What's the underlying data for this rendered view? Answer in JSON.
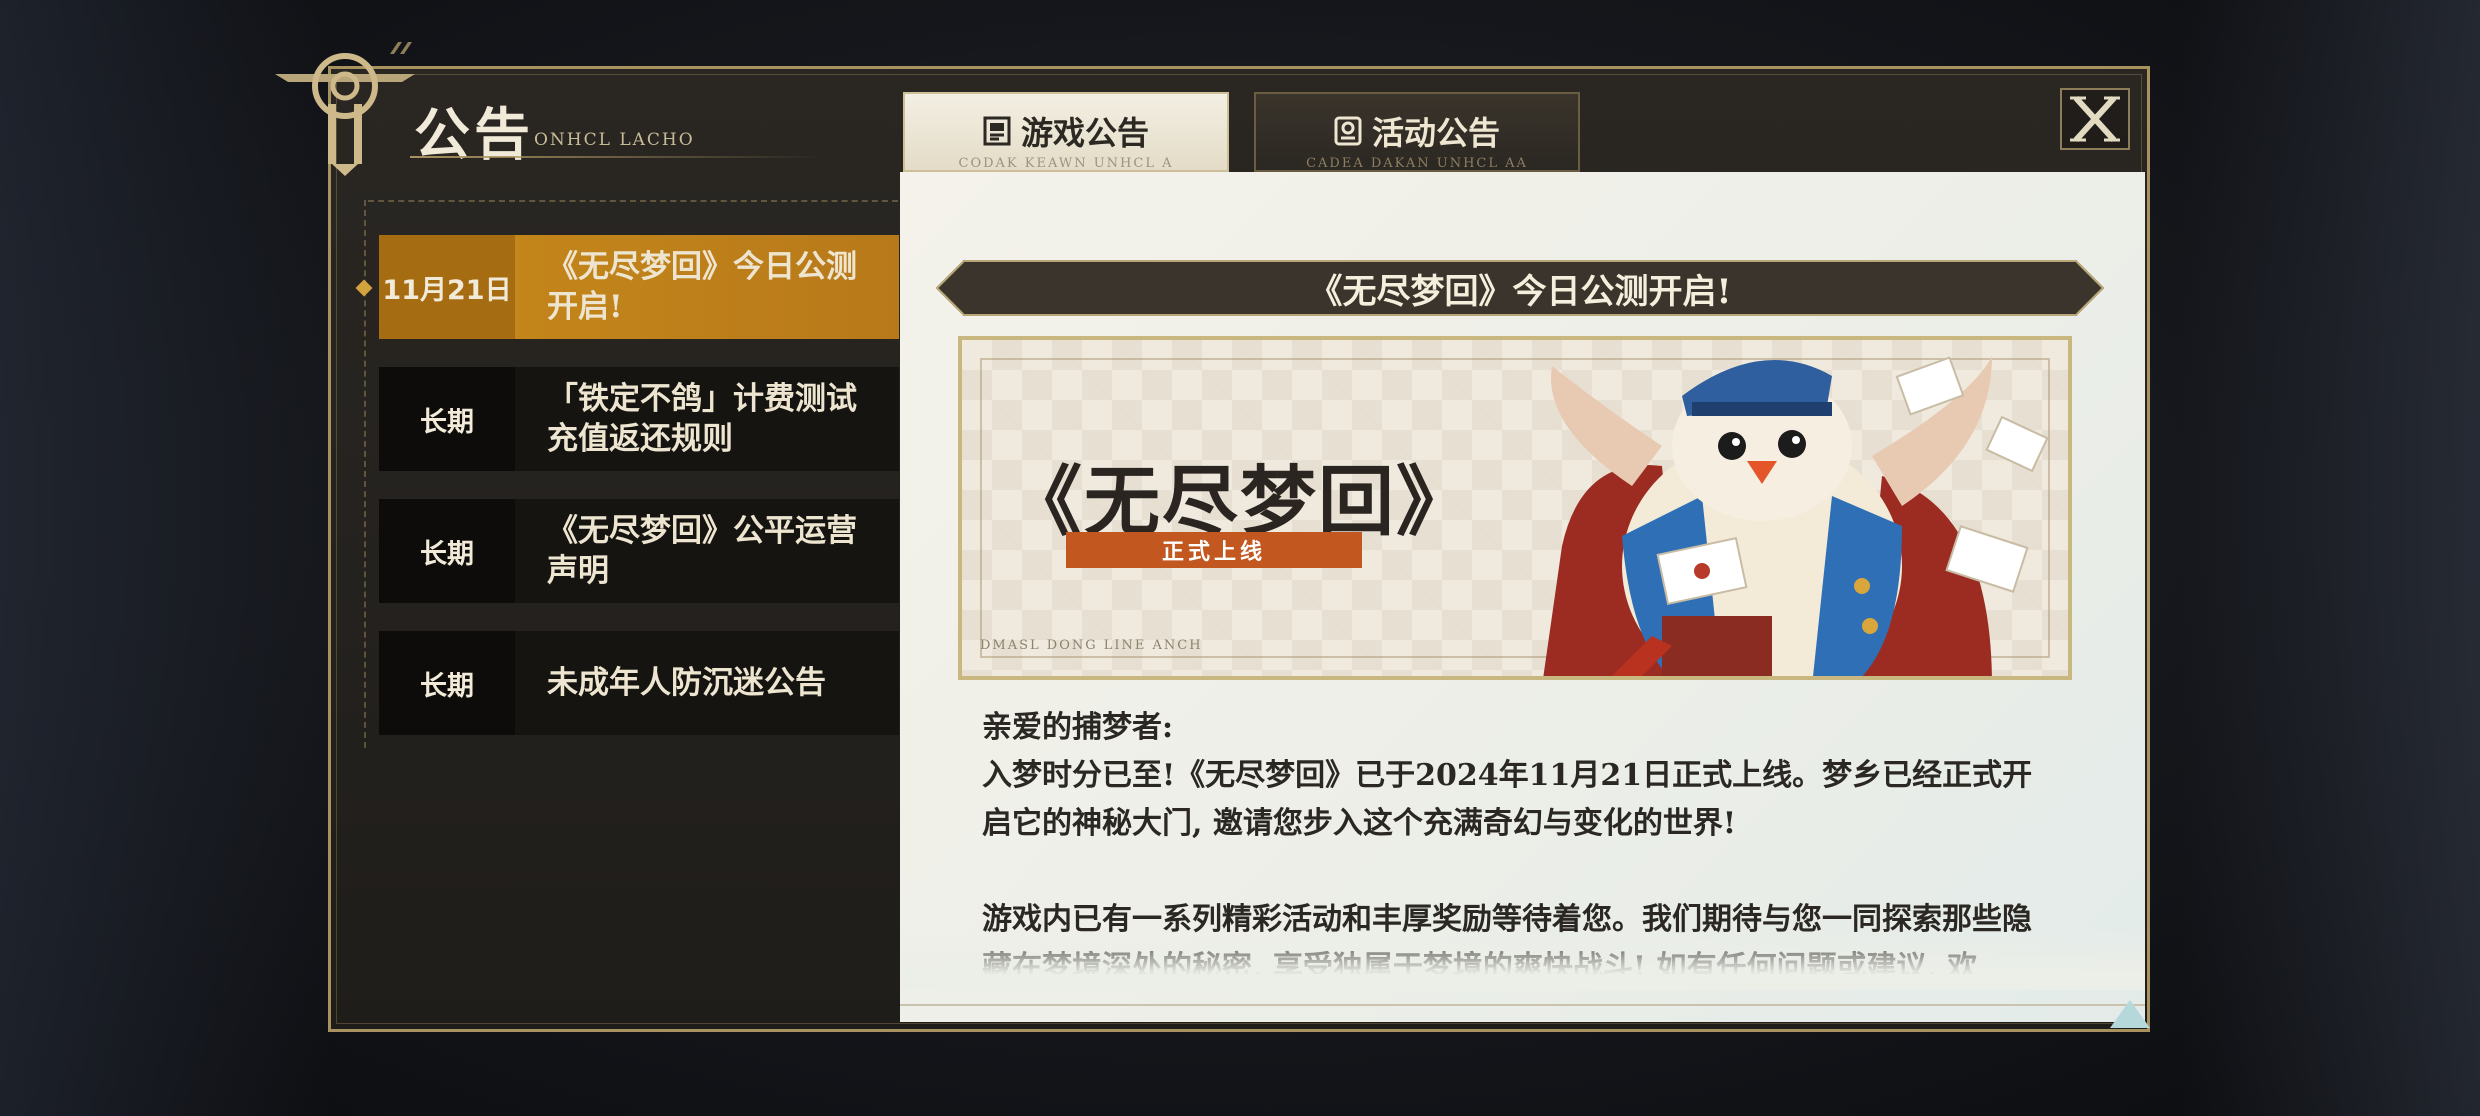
{
  "header": {
    "title": "公告",
    "subtitle": "ONHCL LACHO"
  },
  "tabs": [
    {
      "label": "游戏公告",
      "sub": "CODAK KEAWN UNHCL A",
      "active": true,
      "icon": "notice-icon"
    },
    {
      "label": "活动公告",
      "sub": "CADEA DAKAN UNHCL AA",
      "active": false,
      "icon": "event-icon"
    }
  ],
  "close_icon": "close-icon",
  "list": [
    {
      "date": "11月21日",
      "title": "《无尽梦回》今日公测开启!",
      "active": true
    },
    {
      "date": "长期",
      "title": "「铁定不鸽」计费测试充值返还规则",
      "active": false
    },
    {
      "date": "长期",
      "title": "《无尽梦回》公平运营声明",
      "active": false
    },
    {
      "date": "长期",
      "title": "未成年人防沉迷公告",
      "active": false
    }
  ],
  "article": {
    "heading": "《无尽梦回》今日公测开启!",
    "banner_title": "《无尽梦回》",
    "banner_tag": "正式上线",
    "banner_foot": "DMASL DONG LINE ANCH",
    "greeting": "亲爱的捕梦者:",
    "para1": "入梦时分已至!《无尽梦回》已于2024年11月21日正式上线。梦乡已经正式开启它的神秘大门, 邀请您步入这个充满奇幻与变化的世界!",
    "para2": "游戏内已有一系列精彩活动和丰厚奖励等待着您。我们期待与您一同探索那些隐藏在梦境深处的秘密, 享受独属于梦境的爽快战斗! 如有任何问题或建议, 欢"
  },
  "colors": {
    "gold": "#a89360",
    "active_item": "#c78a1a",
    "tag": "#c2581f"
  }
}
